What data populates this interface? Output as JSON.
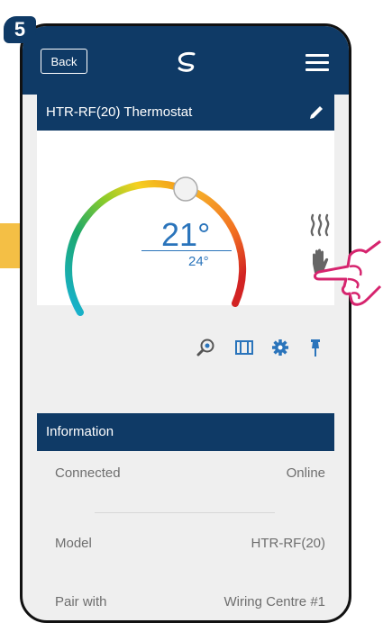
{
  "step": {
    "number": "5"
  },
  "topbar": {
    "back_label": "Back",
    "logo_icon": "swirl-logo-icon",
    "menu_icon": "hamburger-menu-icon"
  },
  "device_card": {
    "title": "HTR-RF(20) Thermostat",
    "edit_icon": "pencil-icon",
    "current_temp": "21°",
    "target_temp": "24°",
    "mode_icons": [
      "heat-icon",
      "hand-icon"
    ]
  },
  "tools": [
    "search-icon",
    "schedule-icon",
    "gear-icon",
    "pin-icon"
  ],
  "information": {
    "header": "Information",
    "rows": [
      {
        "label": "Connected",
        "value": "Online"
      },
      {
        "label": "Model",
        "value": "HTR-RF(20)"
      },
      {
        "label": "Pair with",
        "value": "Wiring Centre #1"
      }
    ]
  },
  "colors": {
    "navy": "#0f3a66",
    "accent_blue": "#2a74bb",
    "arrow_yellow": "#f4bf45",
    "pointer_magenta": "#d6246e"
  }
}
